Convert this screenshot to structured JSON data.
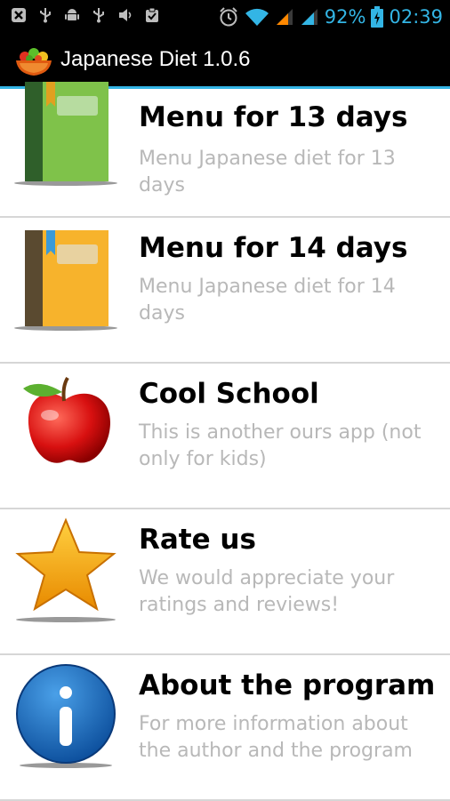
{
  "status_bar": {
    "left_icons": [
      "notification-icon",
      "usb-icon",
      "android-debug-icon",
      "usb-icon",
      "volume-icon",
      "clipboard-icon"
    ],
    "battery_percent": "92%",
    "time": "02:39",
    "accent_color": "#33b5e5"
  },
  "action_bar": {
    "app_title": "Japanese Diet 1.0.6",
    "app_icon": "salad-bowl-icon"
  },
  "menu_items": [
    {
      "title": "Menu for 13 days",
      "subtitle": "Menu Japanese diet for 13 days",
      "icon": "green-book-icon"
    },
    {
      "title": "Menu for 14 days",
      "subtitle": "Menu Japanese diet for 14 days",
      "icon": "orange-book-icon"
    },
    {
      "title": "Cool School",
      "subtitle": "This is another ours app (not only for kids)",
      "icon": "apple-icon"
    },
    {
      "title": "Rate us",
      "subtitle": "We would appreciate your ratings and reviews!",
      "icon": "star-icon"
    },
    {
      "title": "About the program",
      "subtitle": "For more information about the author and the program",
      "icon": "info-icon"
    }
  ]
}
